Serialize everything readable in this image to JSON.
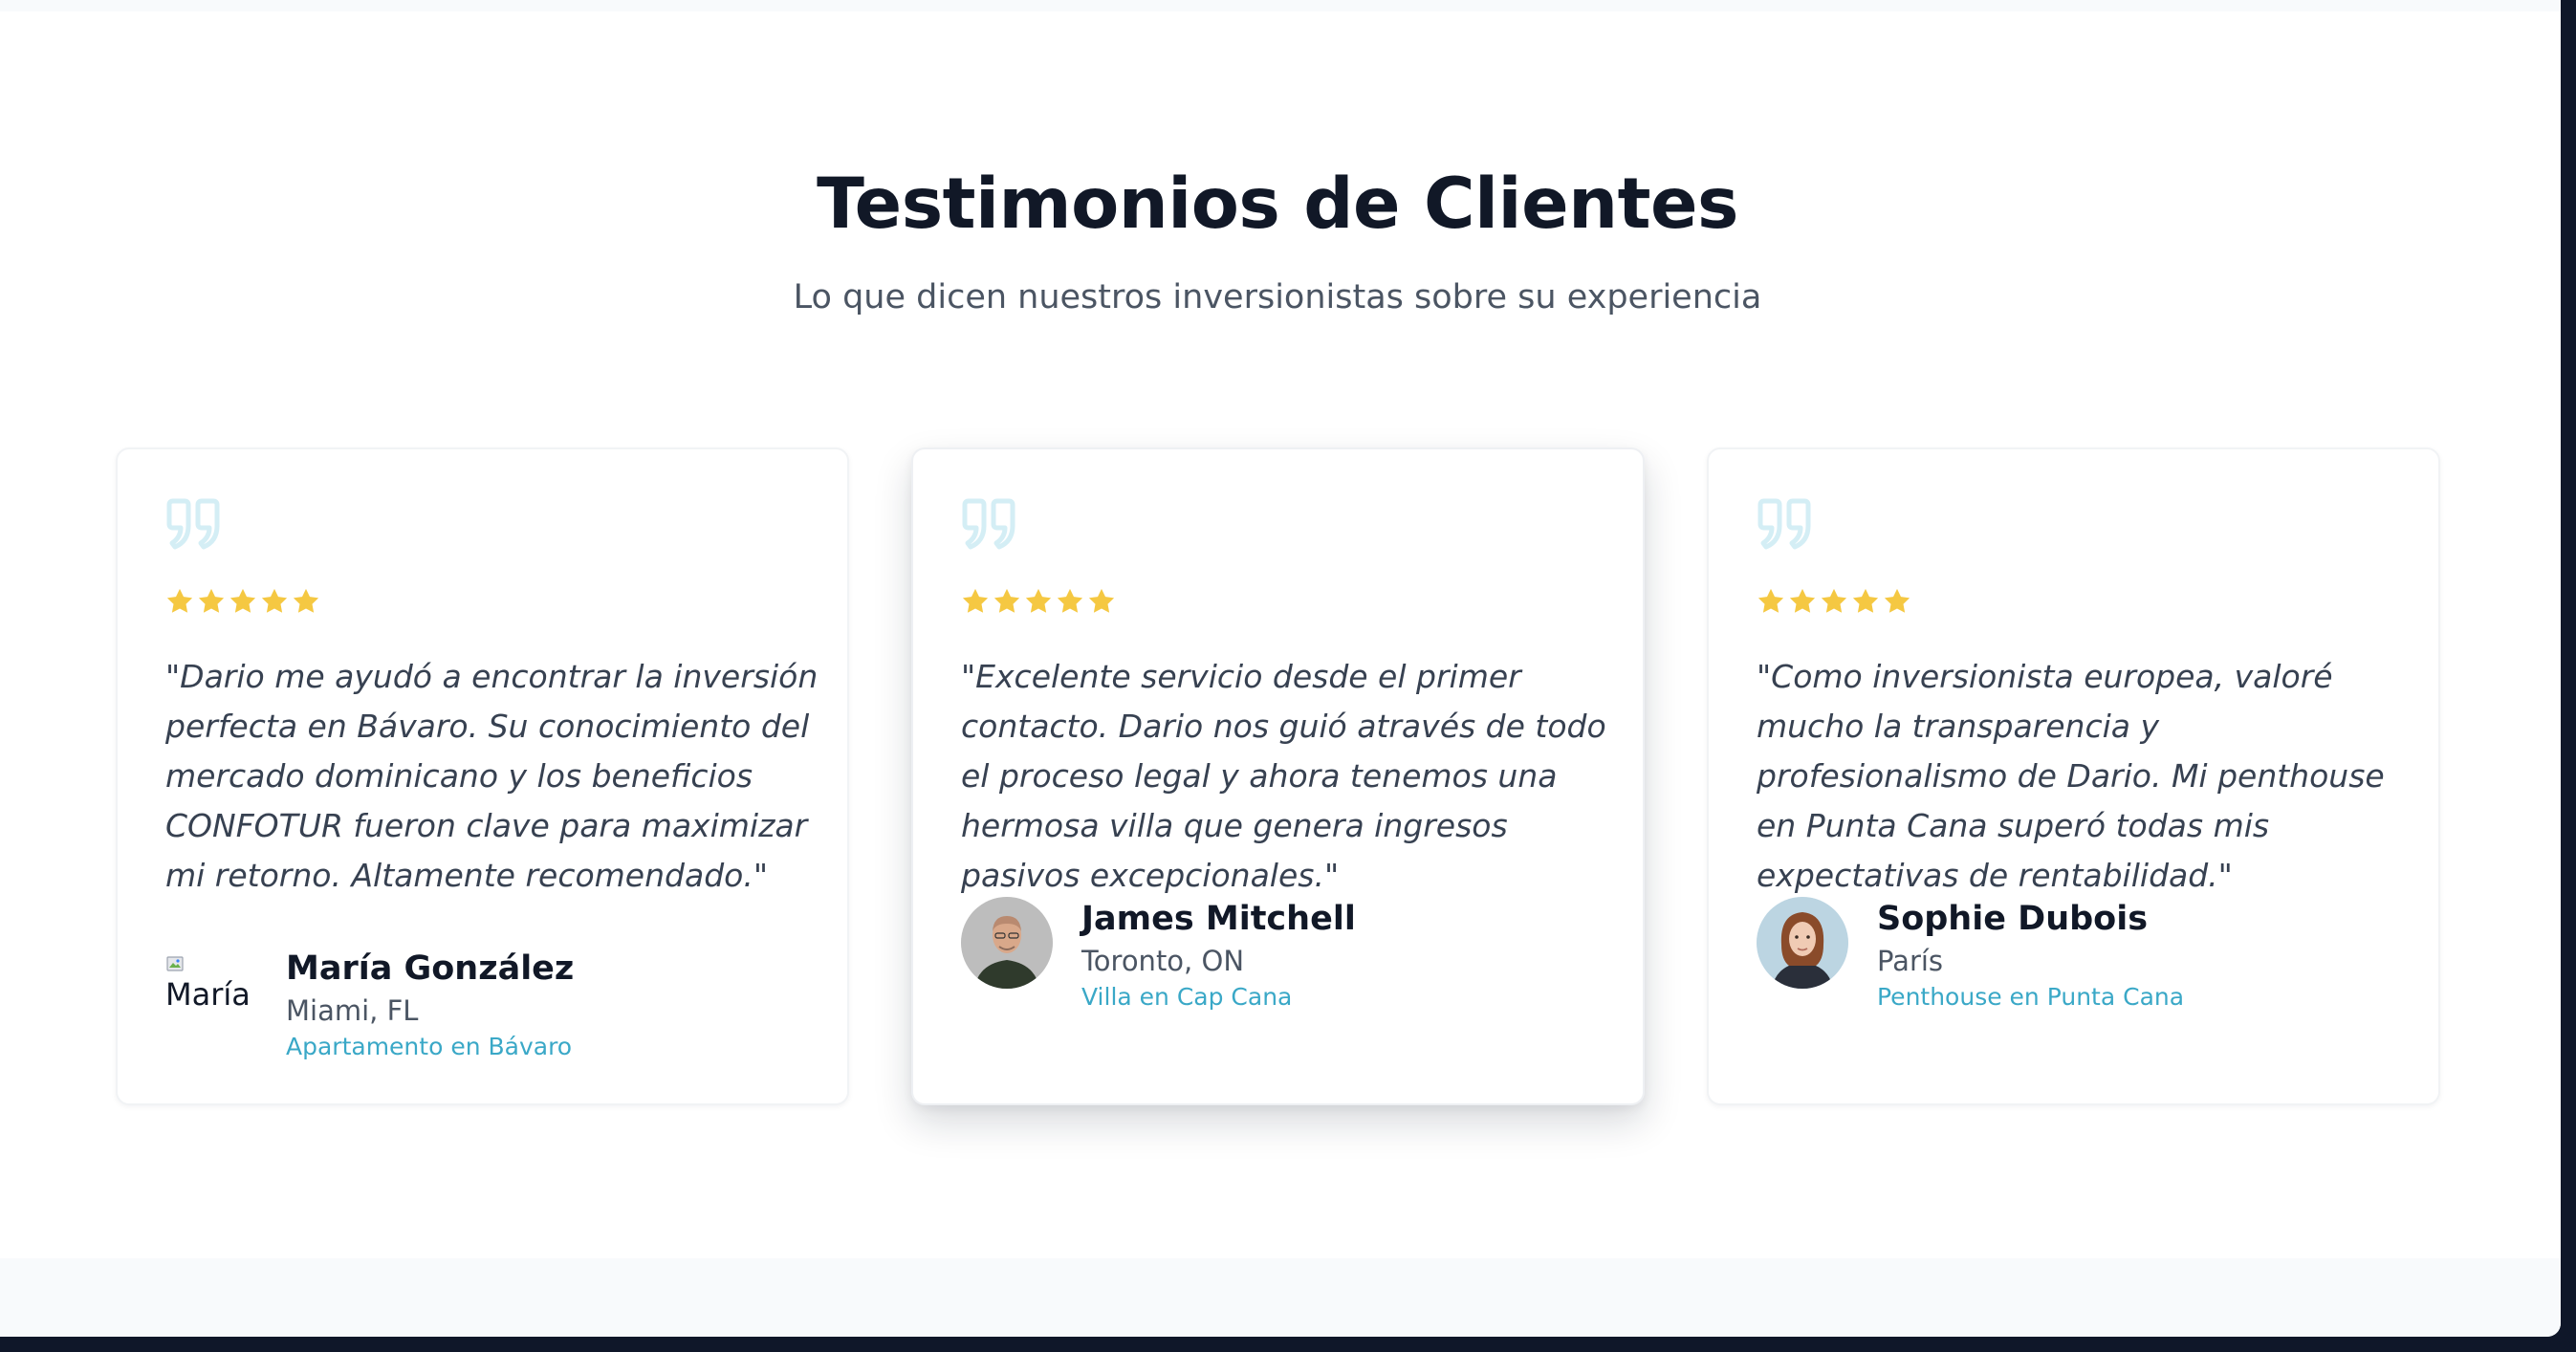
{
  "section": {
    "title": "Testimonios de Clientes",
    "subtitle": "Lo que dicen nuestros inversionistas sobre su experiencia"
  },
  "colors": {
    "accent": "#3aa8c7",
    "quote_icon": "#d4eef5",
    "star": "#f5c842",
    "title": "#111827",
    "body_text": "#374151"
  },
  "testimonials": [
    {
      "rating": 5,
      "quote": "\"Dario me ayudó a encontrar la inversión perfecta en Bávaro. Su conocimiento del mercado dominicano y los beneficios CONFOTUR fueron clave para maximizar mi retorno. Altamente recomendado.\"",
      "avatar_alt": "María",
      "name": "María González",
      "location": "Miami, FL",
      "property": "Apartamento en Bávaro"
    },
    {
      "rating": 5,
      "quote": "\"Excelente servicio desde el primer contacto. Dario nos guió através de todo el proceso legal y ahora tenemos una hermosa villa que genera ingresos pasivos excepcionales.\"",
      "name": "James Mitchell",
      "location": "Toronto, ON",
      "property": "Villa en Cap Cana"
    },
    {
      "rating": 5,
      "quote": "\"Como inversionista europea, valoré mucho la transparencia y profesionalismo de Dario. Mi penthouse en Punta Cana superó todas mis expectativas de rentabilidad.\"",
      "name": "Sophie Dubois",
      "location": "París",
      "property": "Penthouse en Punta Cana"
    }
  ]
}
